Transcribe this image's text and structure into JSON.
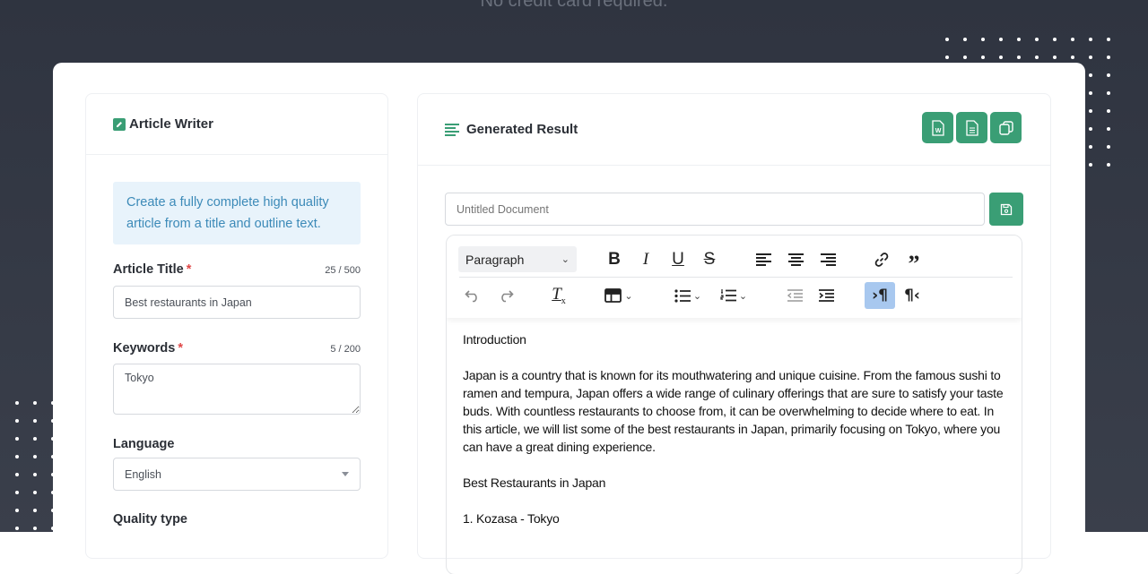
{
  "hero": {
    "subtitle": "No credit card required."
  },
  "left": {
    "title": "Article Writer",
    "info": "Create a fully complete high quality article from a title and outline text.",
    "article_title": {
      "label": "Article Title",
      "required": "*",
      "counter": "25 / 500",
      "value": "Best restaurants in Japan"
    },
    "keywords": {
      "label": "Keywords",
      "required": "*",
      "counter": "5 / 200",
      "value": "Tokyo"
    },
    "language": {
      "label": "Language",
      "value": "English"
    },
    "quality": {
      "label": "Quality type"
    }
  },
  "right": {
    "title": "Generated Result",
    "doc_placeholder": "Untitled Document",
    "buttons": [
      "word-export-icon",
      "document-export-icon",
      "copy-icon"
    ],
    "toolbar": {
      "block_format": "Paragraph",
      "row1": [
        "bold",
        "italic",
        "underline",
        "strikethrough",
        "align-left",
        "align-center",
        "align-right",
        "link",
        "blockquote"
      ],
      "row2": [
        "undo",
        "redo",
        "clear-formatting",
        "table",
        "bulleted-list",
        "numbered-list",
        "outdent",
        "indent",
        "ltr",
        "rtl"
      ]
    },
    "content": {
      "p1": "Introduction",
      "p2": "Japan is a country that is known for its mouthwatering and unique cuisine. From the famous sushi to ramen and tempura, Japan offers a wide range of culinary offerings that are sure to satisfy your taste buds. With countless restaurants to choose from, it can be overwhelming to decide where to eat. In this article, we will list some of the best restaurants in Japan, primarily focusing on Tokyo, where you can have a great dining experience.",
      "p3": "Best Restaurants in Japan",
      "p4": "1. Kozasa - Tokyo"
    }
  },
  "colors": {
    "accent": "#3a9e75",
    "info_bg": "#e8f3fb",
    "info_text": "#3c8ab8",
    "hero_bg": "#2f3440"
  }
}
